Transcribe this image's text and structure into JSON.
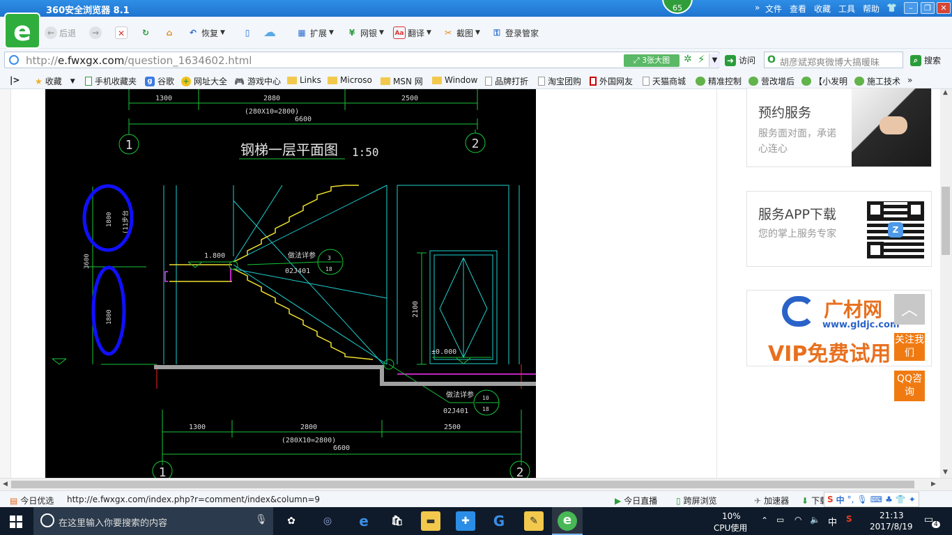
{
  "window": {
    "title": "360安全浏览器 8.1",
    "badge": "65",
    "menu": [
      "文件",
      "查看",
      "收藏",
      "工具",
      "帮助"
    ]
  },
  "toolbar": {
    "back": "后退",
    "restore": "恢复",
    "extensions": "扩展",
    "netbank": "网银",
    "translate": "翻译",
    "screenshot": "截图",
    "login_manager": "登录管家"
  },
  "address": {
    "url_prefix": "http://",
    "url_domain": "e.fwxgx.com",
    "url_path": "/question_1634602.html",
    "big_image_btn": "3张大图",
    "visit": "访问",
    "search_value": "胡彦斌郑爽微博大搞暖昧",
    "search_btn": "搜索"
  },
  "bookmarks": [
    {
      "label": "收藏",
      "icon": "star-icon"
    },
    {
      "label": "手机收藏夹",
      "icon": "phone-icon"
    },
    {
      "label": "谷歌",
      "icon": "google-icon"
    },
    {
      "label": "网址大全",
      "icon": "plus-icon"
    },
    {
      "label": "游戏中心",
      "icon": "gamepad-icon"
    },
    {
      "label": "Links",
      "icon": "folder-icon"
    },
    {
      "label": "Microso",
      "icon": "folder-icon"
    },
    {
      "label": "MSN 网",
      "icon": "folder-icon"
    },
    {
      "label": "Window",
      "icon": "folder-icon"
    },
    {
      "label": "品牌打折",
      "icon": "page-icon"
    },
    {
      "label": "淘宝团购",
      "icon": "page-icon"
    },
    {
      "label": "外国网友",
      "icon": "page-icon"
    },
    {
      "label": "天猫商城",
      "icon": "page-icon"
    },
    {
      "label": "精准控制",
      "icon": "wechat-icon"
    },
    {
      "label": "营改增后",
      "icon": "wechat-icon"
    },
    {
      "label": "【小发明",
      "icon": "wechat-icon"
    },
    {
      "label": "施工技术",
      "icon": "wechat-icon"
    }
  ],
  "cad": {
    "dims_top": [
      "1300",
      "2880",
      "2500"
    ],
    "dim_top_sub": "(280X10=2800)",
    "dim_top_total": "6600",
    "axis_1": "1",
    "axis_2": "2",
    "drawing_title": "钢梯一层平面图",
    "scale": "1:50",
    "dim_left_total": "3600",
    "dim_left_a": "1800",
    "dim_left_b": "1800",
    "dim_left_note": "(11步台",
    "landing_dim": "1.800",
    "detail_note": "做法详参",
    "detail_std": "02J401",
    "detail1_top": "3",
    "detail1_bottom": "18",
    "door_height": "2100",
    "floor_level": "±0.000",
    "detail2_top": "10",
    "detail2_bottom": "18",
    "dims_bottom": [
      "1300",
      "2800",
      "2500"
    ],
    "dim_bottom_sub": "(280X10=2800)",
    "dim_bottom_total": "6600"
  },
  "sidebar": {
    "card1_title": "预约服务",
    "card1_desc": "服务面对面，承诺心连心",
    "card2_title": "服务APP下载",
    "card2_desc": "您的掌上服务专家",
    "ad_brand": "广材网",
    "ad_url": "www.gldjc.com",
    "ad_text": "VIP免费试用",
    "follow_btn": "关注我们",
    "qq_btn": "QQ咨询"
  },
  "statusbar": {
    "today": "今日优选",
    "link": "http://e.fwxgx.com/index.php?r=comment/index&column=9",
    "live": "今日直播",
    "cross_screen": "跨屏浏览",
    "accelerator": "加速器",
    "download": "下载"
  },
  "taskbar": {
    "search_placeholder": "在这里输入你要搜索的内容",
    "cpu_percent": "10%",
    "cpu_label": "CPU使用",
    "ime": "中",
    "time": "21:13",
    "date": "2017/8/19",
    "notifications": "4"
  }
}
